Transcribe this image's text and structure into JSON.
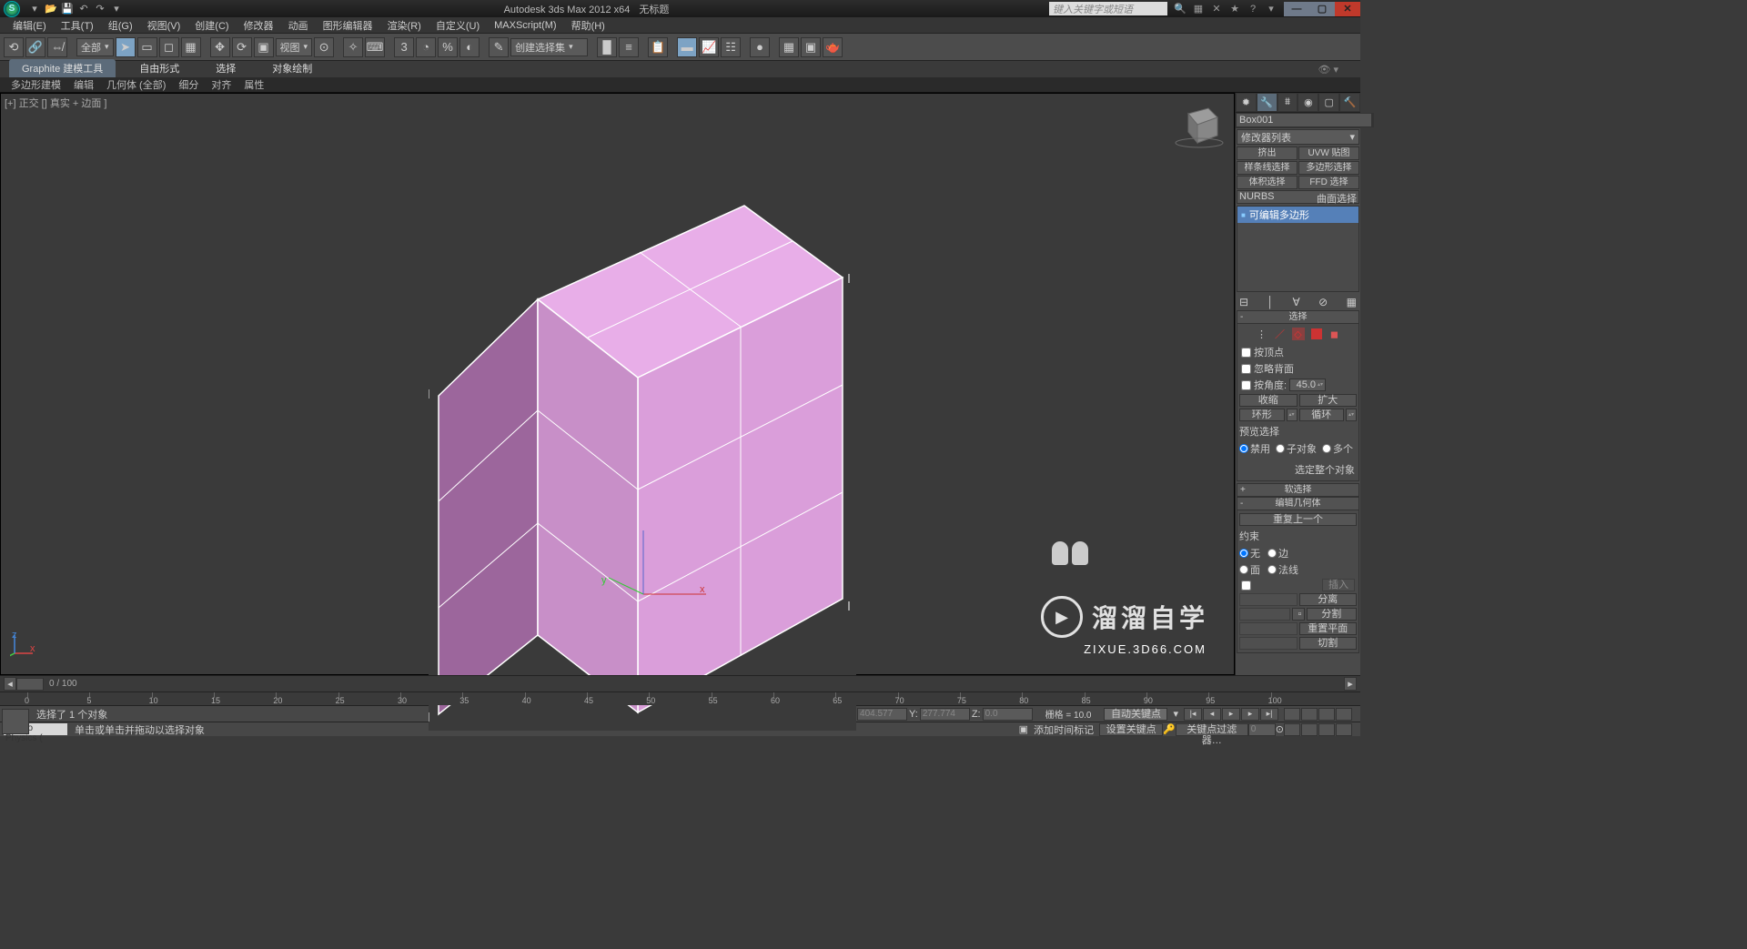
{
  "title_left": "Autodesk 3ds Max 2012 x64",
  "title_doc": "无标题",
  "search_placeholder": "键入关键字或短语",
  "menubar": [
    "编辑(E)",
    "工具(T)",
    "组(G)",
    "视图(V)",
    "创建(C)",
    "修改器",
    "动画",
    "图形编辑器",
    "渲染(R)",
    "自定义(U)",
    "MAXScript(M)",
    "帮助(H)"
  ],
  "toolbar": {
    "scope": "全部",
    "view_dd": "视图",
    "selset": "创建选择集"
  },
  "ribbon": {
    "tabs": [
      "Graphite 建模工具",
      "自由形式",
      "选择",
      "对象绘制"
    ],
    "subtabs": [
      "多边形建模",
      "编辑",
      "几何体 (全部)",
      "细分",
      "对齐",
      "属性"
    ]
  },
  "viewport_label": "[+] 正交 [] 真实 + 边面 ]",
  "cmd": {
    "object_name": "Box001",
    "mod_dd": "修改器列表",
    "mod_buttons": [
      "挤出",
      "UVW 贴图",
      "样条线选择",
      "多边形选择",
      "体积选择",
      "FFD 选择"
    ],
    "nurbs": "曲面选择",
    "nurbs_pref": "NURBS",
    "mod_stack_item": "可编辑多边形",
    "rollout_select": "选择",
    "chk_vertex": "按顶点",
    "chk_backface": "忽略背面",
    "chk_angle": "按角度:",
    "angle_val": "45.0",
    "btn_shrink": "收缩",
    "btn_grow": "扩大",
    "btn_ring": "环形",
    "btn_loop": "循环",
    "preview_label": "预览选择",
    "radio_off": "禁用",
    "radio_subobj": "子对象",
    "radio_multi": "多个",
    "sel_whole": "选定整个对象",
    "rollout_soft": "软选择",
    "rollout_editgeo": "编辑几何体",
    "repeat_last": "重复上一个",
    "constraints": "约束",
    "c_none": "无",
    "c_edge": "边",
    "c_face": "面",
    "c_normal": "法线",
    "btn_inset": "插入",
    "btn_detach": "分离",
    "btn_split": "分割",
    "lbl_reset_plane": "重置平面",
    "btn_cut": "切割"
  },
  "timeline": {
    "pos": "0 / 100",
    "ticks": [
      "0",
      "5",
      "10",
      "15",
      "20",
      "25",
      "30",
      "35",
      "40",
      "45",
      "50",
      "55",
      "60",
      "65",
      "70",
      "75",
      "80",
      "85",
      "90",
      "95",
      "100"
    ]
  },
  "status": {
    "selected": "选择了 1 个对象",
    "prompt": "单击或单击并拖动以选择对象",
    "maxscript": "Max to Physics (",
    "x": "404.577",
    "y": "277.774",
    "z": "0.0",
    "grid": "栅格 = 10.0",
    "autokey": "自动关键点",
    "setkey": "设置关键点",
    "keyfilter": "关键点过滤器…",
    "addtimetag": "添加时间标记"
  },
  "watermark": {
    "text": "溜溜自学",
    "url": "ZIXUE.3D66.COM"
  }
}
